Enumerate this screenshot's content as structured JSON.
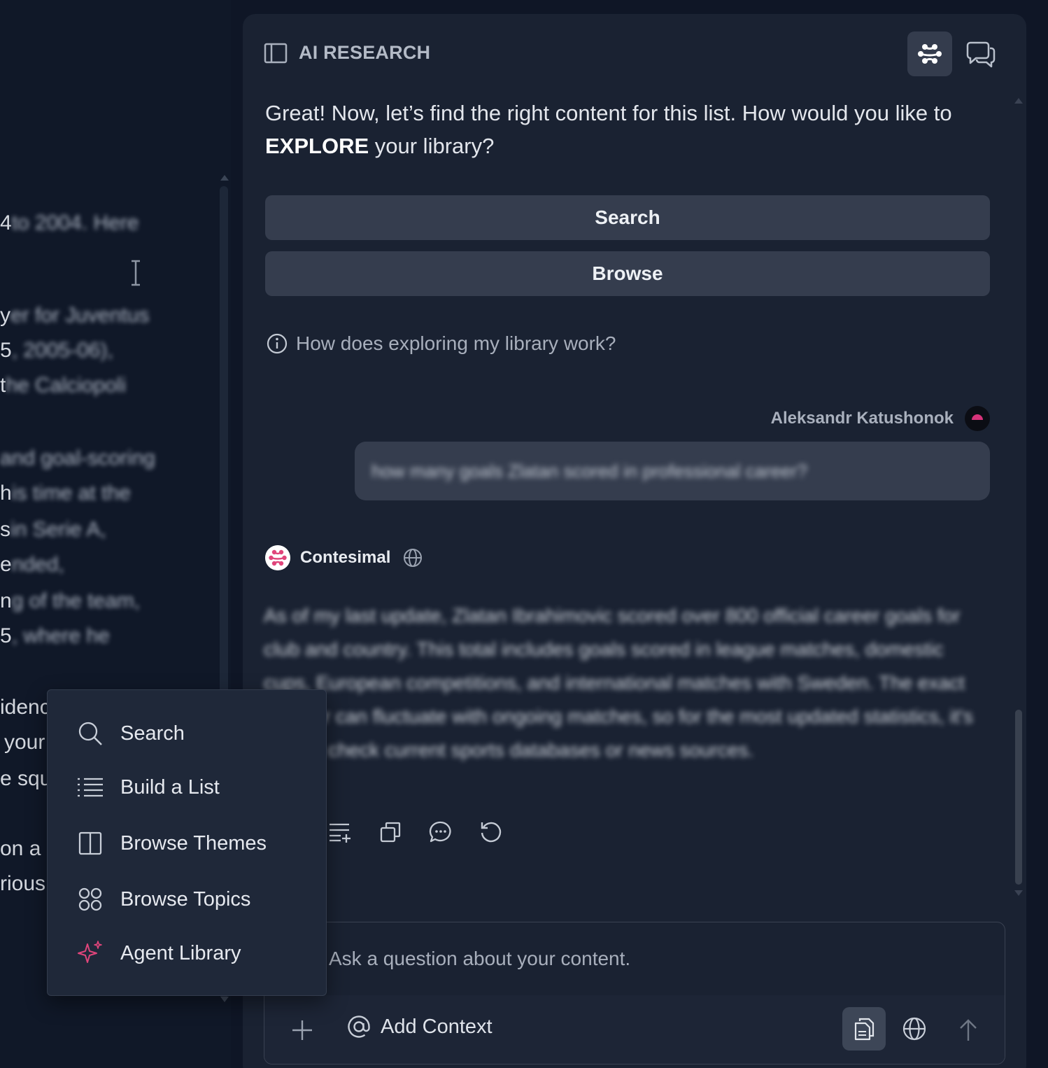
{
  "document": {
    "lines": [
      {
        "lead": "4",
        "rest": "to 2004. Here"
      },
      {
        "lead": "y",
        "rest": "er for Juventus"
      },
      {
        "lead": "5",
        "rest": ", 2005-06),"
      },
      {
        "lead": "t",
        "rest": "he Calciopoli"
      },
      {
        "lead": "",
        "rest": "and goal-scoring"
      },
      {
        "lead": "h",
        "rest": "is time at the"
      },
      {
        "lead": "s",
        "rest": "in Serie A,"
      },
      {
        "lead": "e",
        "rest": "nded,"
      },
      {
        "lead": "n",
        "rest": "g of the team,"
      },
      {
        "lead": "5",
        "rest": ", where he"
      }
    ],
    "clear_lines": [
      "idenc",
      "your",
      "e squ",
      "on a",
      "rious"
    ]
  },
  "panel": {
    "title": "AI RESEARCH",
    "intro_prefix": "Great! Now, let’s find the right content for this list. How would you like to ",
    "intro_bold": "EXPLORE",
    "intro_suffix": " your library?",
    "buttons": {
      "search": "Search",
      "browse": "Browse"
    },
    "help_text": "How does exploring my library work?"
  },
  "conversation": {
    "user": {
      "name": "Aleksandr Katushonok",
      "message": "how many goals Zlatan scored in professional career?"
    },
    "bot": {
      "name": "Contesimal",
      "message": "As of my last update, Zlatan Ibrahimovic scored over 800 official career goals for club and country. This total includes goals scored in league matches, domestic cups, European competitions, and international matches with Sweden. The exact number can fluctuate with ongoing matches, so for the most updated statistics, it's best to check current sports databases or news sources."
    }
  },
  "composer": {
    "placeholder": "Ask a question about your content.",
    "add_context": "Add Context"
  },
  "menu": {
    "items": [
      {
        "label": "Search",
        "icon": "search-icon"
      },
      {
        "label": "Build a List",
        "icon": "list-icon"
      },
      {
        "label": "Browse Themes",
        "icon": "columns-icon"
      },
      {
        "label": "Browse Topics",
        "icon": "grid-circles-icon"
      },
      {
        "label": "Agent Library",
        "icon": "sparkle-icon"
      }
    ]
  },
  "colors": {
    "background": "#0f1626",
    "panel": "#1a2232",
    "button": "#353d4e",
    "accent_pink": "#e0457b"
  }
}
